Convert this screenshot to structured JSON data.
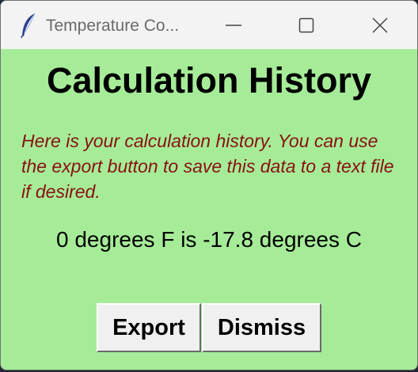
{
  "window": {
    "title": "Temperature Co...",
    "app_icon": "feather-icon",
    "controls": {
      "minimize_icon": "minimize-icon",
      "maximize_icon": "maximize-icon",
      "close_icon": "close-icon"
    }
  },
  "main": {
    "heading": "Calculation History",
    "description": "Here is your calculation history.  You can use the export button to save this data to a text file if desired.",
    "history": [
      "0 degrees F is -17.8 degrees C"
    ]
  },
  "buttons": {
    "export_label": "Export",
    "dismiss_label": "Dismiss"
  },
  "colors": {
    "background": "#a6ec98",
    "description_text": "#8a1010",
    "titlebar": "#f3f3f3"
  }
}
